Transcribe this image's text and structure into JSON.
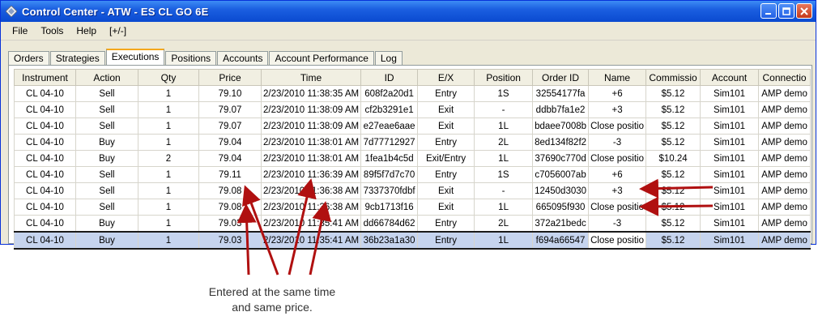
{
  "window": {
    "title": "Control Center - ATW - ES CL GO 6E"
  },
  "menu": [
    "File",
    "Tools",
    "Help",
    "[+/-]"
  ],
  "tabs": [
    "Orders",
    "Strategies",
    "Executions",
    "Positions",
    "Accounts",
    "Account Performance",
    "Log"
  ],
  "active_tab": 2,
  "table": {
    "columns": [
      "Instrument",
      "Action",
      "Qty",
      "Price",
      "Time",
      "ID",
      "E/X",
      "Position",
      "Order ID",
      "Name",
      "Commissio",
      "Account",
      "Connectio"
    ],
    "rows": [
      [
        "CL 04-10",
        "Sell",
        "1",
        "79.10",
        "2/23/2010 11:38:35 AM",
        "608f2a20d1",
        "Entry",
        "1S",
        "32554177fa",
        "+6",
        "$5.12",
        "Sim101",
        "AMP demo"
      ],
      [
        "CL 04-10",
        "Sell",
        "1",
        "79.07",
        "2/23/2010 11:38:09 AM",
        "cf2b3291e1",
        "Exit",
        "-",
        "ddbb7fa1e2",
        "+3",
        "$5.12",
        "Sim101",
        "AMP demo"
      ],
      [
        "CL 04-10",
        "Sell",
        "1",
        "79.07",
        "2/23/2010 11:38:09 AM",
        "e27eae6aae",
        "Exit",
        "1L",
        "bdaee7008b",
        "Close positio",
        "$5.12",
        "Sim101",
        "AMP demo"
      ],
      [
        "CL 04-10",
        "Buy",
        "1",
        "79.04",
        "2/23/2010 11:38:01 AM",
        "7d77712927",
        "Entry",
        "2L",
        "8ed134f82f2",
        "-3",
        "$5.12",
        "Sim101",
        "AMP demo"
      ],
      [
        "CL 04-10",
        "Buy",
        "2",
        "79.04",
        "2/23/2010 11:38:01 AM",
        "1fea1b4c5d",
        "Exit/Entry",
        "1L",
        "37690c770d",
        "Close positio",
        "$10.24",
        "Sim101",
        "AMP demo"
      ],
      [
        "CL 04-10",
        "Sell",
        "1",
        "79.11",
        "2/23/2010 11:36:39 AM",
        "89f5f7d7c70",
        "Entry",
        "1S",
        "c7056007ab",
        "+6",
        "$5.12",
        "Sim101",
        "AMP demo"
      ],
      [
        "CL 04-10",
        "Sell",
        "1",
        "79.08",
        "2/23/2010 11:36:38 AM",
        "7337370fdbf",
        "Exit",
        "-",
        "12450d3030",
        "+3",
        "$5.12",
        "Sim101",
        "AMP demo"
      ],
      [
        "CL 04-10",
        "Sell",
        "1",
        "79.08",
        "2/23/2010 11:36:38 AM",
        "9cb1713f16",
        "Exit",
        "1L",
        "665095f930",
        "Close positio",
        "$5.12",
        "Sim101",
        "AMP demo"
      ],
      [
        "CL 04-10",
        "Buy",
        "1",
        "79.03",
        "2/23/2010 11:35:41 AM",
        "dd66784d62",
        "Entry",
        "2L",
        "372a21bedc",
        "-3",
        "$5.12",
        "Sim101",
        "AMP demo"
      ],
      [
        "CL 04-10",
        "Buy",
        "1",
        "79.03",
        "2/23/2010 11:35:41 AM",
        "36b23a1a30",
        "Entry",
        "1L",
        "f694a66547",
        "Close positio",
        "$5.12",
        "Sim101",
        "AMP demo"
      ]
    ],
    "selected_row": 9
  },
  "annotation": {
    "line1": "Entered at the same time",
    "line2": "and same price.",
    "arrow_color": "#b01010"
  }
}
